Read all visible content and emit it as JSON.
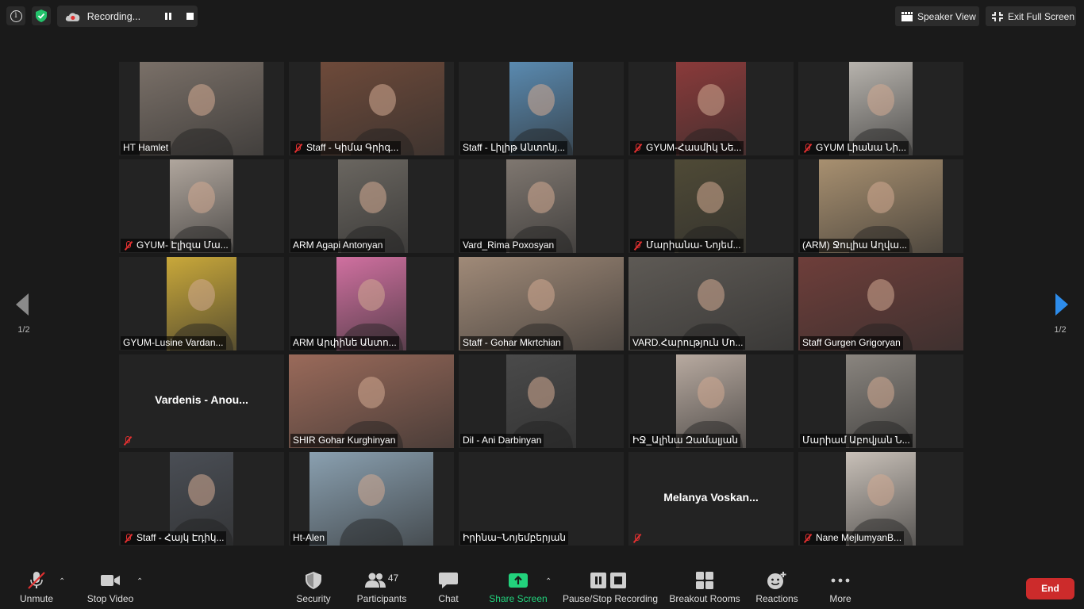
{
  "recording": {
    "label": "Recording..."
  },
  "top_buttons": {
    "speaker_view": "Speaker View",
    "exit_full_screen": "Exit Full Screen"
  },
  "pager": {
    "left": "1/2",
    "right": "1/2"
  },
  "tiles": [
    {
      "name": "HT Hamlet",
      "muted": false,
      "video": true,
      "color": "#7a7068"
    },
    {
      "name": "Staff - Կիմա Գրիգ...",
      "muted": true,
      "video": true,
      "color": "#6e4a3a"
    },
    {
      "name": "Staff - Լիլիթ Անտոնյ...",
      "muted": false,
      "video": true,
      "color": "#5a8ab0"
    },
    {
      "name": "GYUM-Հասմիկ Նե...",
      "muted": true,
      "video": true,
      "color": "#8a3a3a"
    },
    {
      "name": "GYUM Լիանա Նի...",
      "muted": true,
      "video": true,
      "color": "#b7b3ad"
    },
    {
      "name": "GYUM- Էլիզա Մա...",
      "muted": true,
      "video": true,
      "color": "#b0a69d"
    },
    {
      "name": "ARM Agapi Antonyan",
      "muted": false,
      "video": true,
      "color": "#6a6660"
    },
    {
      "name": "Vard_Rima Poxosyan",
      "muted": false,
      "video": true,
      "color": "#7f7770"
    },
    {
      "name": "Մարիանա- Նոյեմ...",
      "muted": true,
      "video": true,
      "color": "#4f4a36"
    },
    {
      "name": "(ARM) Ջուլիա Աղվա...",
      "muted": false,
      "video": true,
      "color": "#a89070"
    },
    {
      "name": "GYUM-Lusine Vardan...",
      "muted": false,
      "video": true,
      "color": "#c9a83a"
    },
    {
      "name": "ARM Արփինե Անտո...",
      "muted": false,
      "video": true,
      "color": "#d070a0"
    },
    {
      "name": "Staff - Gohar Mkrtchian",
      "muted": false,
      "video": true,
      "color": "#a08a78"
    },
    {
      "name": "VARD.Հարություն Մո...",
      "muted": false,
      "video": true,
      "color": "#5e5a55",
      "active": true
    },
    {
      "name": "Staff Gurgen Grigoryan",
      "muted": false,
      "video": true,
      "color": "#6e3e3a"
    },
    {
      "name": "",
      "muted": true,
      "video": false,
      "big": "Vardenis - Anou..."
    },
    {
      "name": "SHIR Gohar Kurghinyan",
      "muted": false,
      "video": true,
      "color": "#9a6a5a"
    },
    {
      "name": "Dil - Ani Darbinyan",
      "muted": false,
      "video": true,
      "color": "#4a4a4a"
    },
    {
      "name": "ԻՋ_Ալինա  Զամալյան",
      "muted": false,
      "video": true,
      "color": "#b8aaa0"
    },
    {
      "name": "Մարիամ Աբովյան Ն...",
      "muted": false,
      "video": true,
      "color": "#8a857f"
    },
    {
      "name": "Staff - Հայկ Էդիկ...",
      "muted": true,
      "video": true,
      "color": "#4a4e55"
    },
    {
      "name": "Ht-Alen",
      "muted": false,
      "video": true,
      "color": "#8aa0b0"
    },
    {
      "name": "Իրինա~Նոյեմբերյան",
      "muted": false,
      "video": false,
      "big": ""
    },
    {
      "name": "",
      "muted": true,
      "video": false,
      "big": "Melanya  Voskan..."
    },
    {
      "name": "Nane MejlumyanB...",
      "muted": true,
      "video": true,
      "color": "#c8c0b8"
    }
  ],
  "toolbar": {
    "unmute": "Unmute",
    "stop_video": "Stop Video",
    "security": "Security",
    "participants": "Participants",
    "participants_count": "47",
    "chat": "Chat",
    "share_screen": "Share Screen",
    "pause_stop_recording": "Pause/Stop Recording",
    "breakout_rooms": "Breakout Rooms",
    "reactions": "Reactions",
    "more": "More",
    "end": "End"
  },
  "colors": {
    "end": "#cc2b2b",
    "share": "#22d27c",
    "active_speaker": "#d8e89a",
    "muted": "#e03030"
  }
}
